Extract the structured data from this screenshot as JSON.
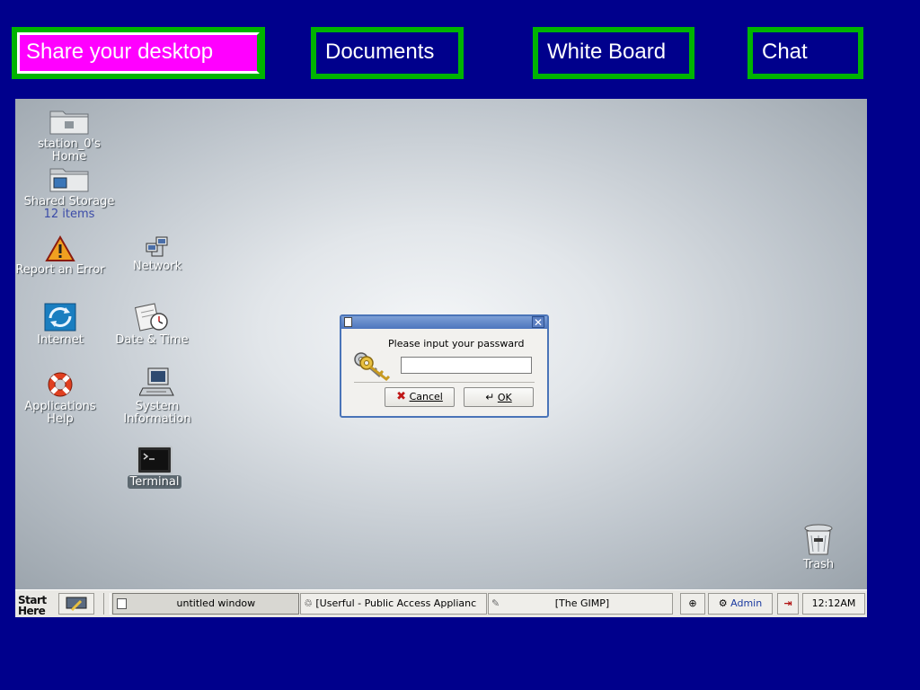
{
  "nav": {
    "share": "Share your desktop",
    "documents": "Documents",
    "whiteboard": "White Board",
    "chat": "Chat"
  },
  "desktop": {
    "icons": {
      "home": {
        "line1": "station_0's",
        "line2": "Home"
      },
      "shared": {
        "line1": "Shared Storage",
        "line2": "12 items"
      },
      "report": "Report an Error",
      "network": "Network",
      "internet": "Internet",
      "datetime": "Date & Time",
      "apphelp": {
        "line1": "Applications",
        "line2": "Help"
      },
      "sysinfo": {
        "line1": "System",
        "line2": "Information"
      },
      "terminal": "Terminal",
      "trash": "Trash"
    }
  },
  "dialog": {
    "prompt": "Please input your passward",
    "password_value": "",
    "cancel_label": "Cancel",
    "ok_label": "OK"
  },
  "taskbar": {
    "start_line1": "Start",
    "start_line2": "Here",
    "tasks": [
      "untitled window",
      "[Userful - Public Access Applianc",
      "[The GIMP]"
    ],
    "user": "Admin",
    "clock": "12:12AM"
  },
  "colors": {
    "background": "#00008c",
    "nav_border": "#00b400",
    "nav_active": "#ff00ff"
  }
}
